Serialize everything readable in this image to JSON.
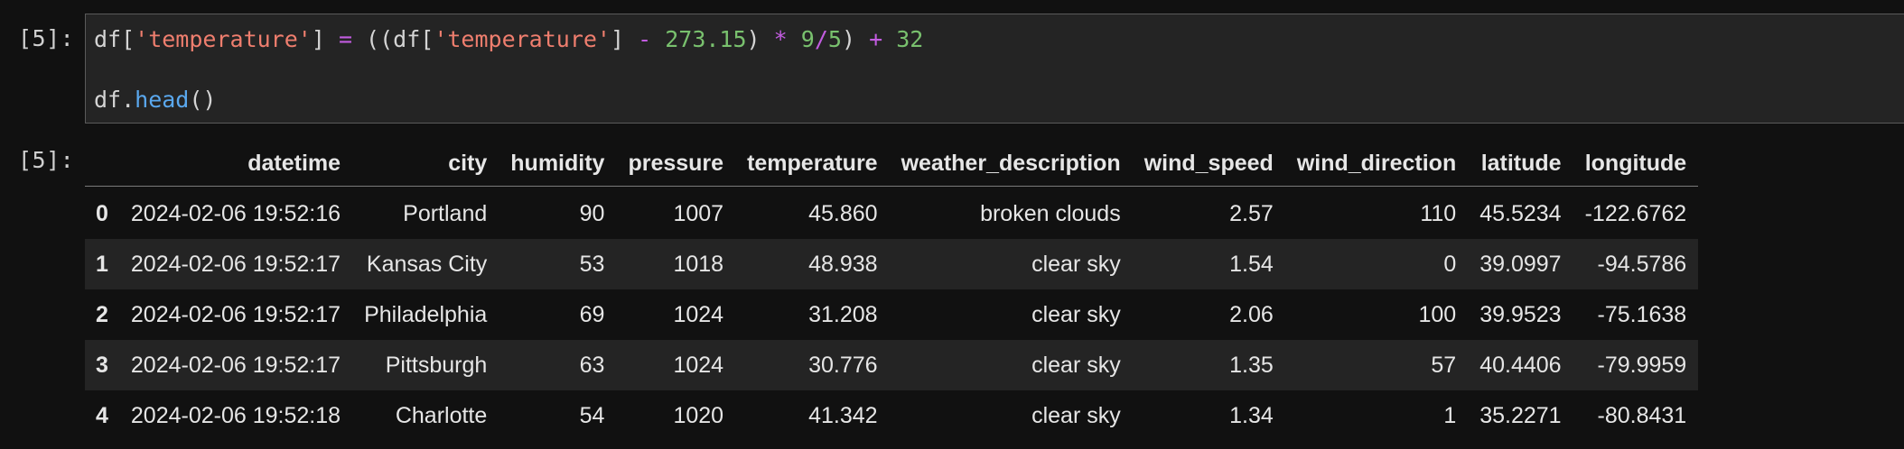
{
  "cell": {
    "input_prompt": "[5]:",
    "output_prompt": "[5]:",
    "code_line1": [
      {
        "t": "df[",
        "c": "pl"
      },
      {
        "t": "'temperature'",
        "c": "str"
      },
      {
        "t": "] ",
        "c": "pl"
      },
      {
        "t": "=",
        "c": "op"
      },
      {
        "t": " ((df[",
        "c": "pl"
      },
      {
        "t": "'temperature'",
        "c": "str"
      },
      {
        "t": "] ",
        "c": "pl"
      },
      {
        "t": "-",
        "c": "op"
      },
      {
        "t": " ",
        "c": "pl"
      },
      {
        "t": "273.15",
        "c": "num"
      },
      {
        "t": ") ",
        "c": "pl"
      },
      {
        "t": "*",
        "c": "op"
      },
      {
        "t": " ",
        "c": "pl"
      },
      {
        "t": "9",
        "c": "num"
      },
      {
        "t": "/",
        "c": "op"
      },
      {
        "t": "5",
        "c": "num"
      },
      {
        "t": ") ",
        "c": "pl"
      },
      {
        "t": "+",
        "c": "op"
      },
      {
        "t": " ",
        "c": "pl"
      },
      {
        "t": "32",
        "c": "num"
      }
    ],
    "code_line2": [
      {
        "t": "df.",
        "c": "pl"
      },
      {
        "t": "head",
        "c": "fn"
      },
      {
        "t": "()",
        "c": "pl"
      }
    ]
  },
  "table": {
    "columns": [
      "",
      "datetime",
      "city",
      "humidity",
      "pressure",
      "temperature",
      "weather_description",
      "wind_speed",
      "wind_direction",
      "latitude",
      "longitude"
    ],
    "rows": [
      [
        "0",
        "2024-02-06 19:52:16",
        "Portland",
        "90",
        "1007",
        "45.860",
        "broken clouds",
        "2.57",
        "110",
        "45.5234",
        "-122.6762"
      ],
      [
        "1",
        "2024-02-06 19:52:17",
        "Kansas City",
        "53",
        "1018",
        "48.938",
        "clear sky",
        "1.54",
        "0",
        "39.0997",
        "-94.5786"
      ],
      [
        "2",
        "2024-02-06 19:52:17",
        "Philadelphia",
        "69",
        "1024",
        "31.208",
        "clear sky",
        "2.06",
        "100",
        "39.9523",
        "-75.1638"
      ],
      [
        "3",
        "2024-02-06 19:52:17",
        "Pittsburgh",
        "63",
        "1024",
        "30.776",
        "clear sky",
        "1.35",
        "57",
        "40.4406",
        "-79.9959"
      ],
      [
        "4",
        "2024-02-06 19:52:18",
        "Charlotte",
        "54",
        "1020",
        "41.342",
        "clear sky",
        "1.34",
        "1",
        "35.2271",
        "-80.8431"
      ]
    ]
  },
  "colors": {
    "background": "#111111",
    "code_background": "#242424",
    "string": "#ef7e6e",
    "number": "#79c16e",
    "operator": "#c25ce0",
    "function": "#5aa8ee"
  }
}
